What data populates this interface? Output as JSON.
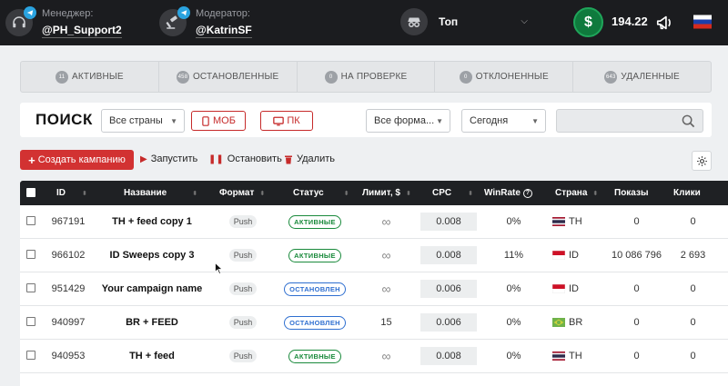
{
  "topbar": {
    "manager": {
      "role": "Менеджер:",
      "name": "@PH_Support2"
    },
    "moderator": {
      "role": "Модератор:",
      "name": "@KatrinSF"
    },
    "tier_select": "Топ",
    "balance": "194.22",
    "currency_symbol": "$",
    "language": "ru"
  },
  "tabs": [
    {
      "count": "11",
      "label": "АКТИВНЫЕ"
    },
    {
      "count": "458",
      "label": "ОСТАНОВЛЕННЫЕ"
    },
    {
      "count": "0",
      "label": "НА ПРОВЕРКЕ"
    },
    {
      "count": "0",
      "label": "ОТКЛОНЕННЫЕ"
    },
    {
      "count": "643",
      "label": "УДАЛЕННЫЕ"
    }
  ],
  "search": {
    "title": "ПОИСК",
    "country_select": "Все страны",
    "mob_label": "МОБ",
    "pc_label": "ПК",
    "format_select": "Все форма...",
    "date_select": "Сегодня",
    "query_value": ""
  },
  "actions": {
    "create": "Создать кампанию",
    "start": "Запустить",
    "stop": "Остановить",
    "delete": "Удалить"
  },
  "table": {
    "headers": {
      "id": "ID",
      "name": "Название",
      "format": "Формат",
      "status": "Статус",
      "limit": "Лимит, $",
      "cpc": "CPC",
      "winrate": "WinRate",
      "country": "Страна",
      "impressions": "Показы",
      "clicks": "Клики"
    },
    "rows": [
      {
        "id": "967191",
        "name": "TH + feed copy 1",
        "format": "Push",
        "status": "АКТИВНЫЕ",
        "status_type": "active",
        "limit": "∞",
        "cpc": "0.008",
        "winrate": "0%",
        "country": "TH",
        "impressions": "0",
        "clicks": "0"
      },
      {
        "id": "966102",
        "name": "ID Sweeps copy 3",
        "format": "Push",
        "status": "АКТИВНЫЕ",
        "status_type": "active",
        "limit": "∞",
        "cpc": "0.008",
        "winrate": "11%",
        "country": "ID",
        "impressions": "10 086 796",
        "clicks": "2 693"
      },
      {
        "id": "951429",
        "name": "Your campaign name",
        "format": "Push",
        "status": "ОСТАНОВЛЕН",
        "status_type": "stopped",
        "limit": "∞",
        "cpc": "0.006",
        "winrate": "0%",
        "country": "ID",
        "impressions": "0",
        "clicks": "0"
      },
      {
        "id": "940997",
        "name": "BR + FEED",
        "format": "Push",
        "status": "ОСТАНОВЛЕН",
        "status_type": "stopped",
        "limit": "15",
        "cpc": "0.006",
        "winrate": "0%",
        "country": "BR",
        "impressions": "0",
        "clicks": "0"
      },
      {
        "id": "940953",
        "name": "TH + feed",
        "format": "Push",
        "status": "АКТИВНЫЕ",
        "status_type": "active",
        "limit": "∞",
        "cpc": "0.008",
        "winrate": "0%",
        "country": "TH",
        "impressions": "0",
        "clicks": "0"
      }
    ]
  },
  "colors": {
    "accent_red": "#d23232",
    "active_green": "#1a8a3c",
    "stopped_blue": "#2f6fd0",
    "topbar_bg": "#1b1c1f"
  }
}
